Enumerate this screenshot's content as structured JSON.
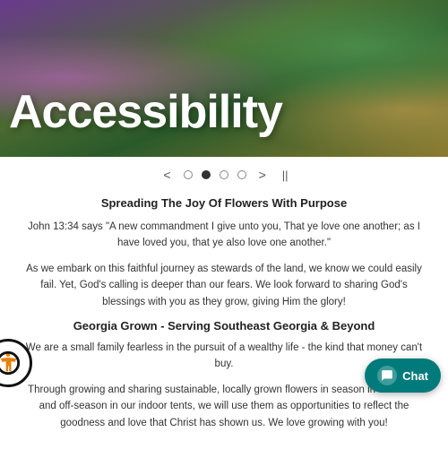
{
  "topbar": {},
  "hero": {
    "title": "Accessibility"
  },
  "carousel": {
    "prev_label": "<",
    "next_label": ">",
    "pause_label": "||",
    "dots": [
      {
        "id": 1,
        "active": false
      },
      {
        "id": 2,
        "active": true
      },
      {
        "id": 3,
        "active": false
      },
      {
        "id": 4,
        "active": false
      }
    ]
  },
  "content": {
    "section1_title": "Spreading The Joy Of Flowers With Purpose",
    "paragraph1": "John 13:34 says \"A new commandment I give unto you, That ye love one another; as I have loved you, that ye also love one another.\"",
    "paragraph2": "As we embark on this faithful journey as stewards of the land, we know we could easily fail. Yet, God's calling is deeper than our fears. We look forward to sharing God's blessings with you as they grow, giving Him the glory!",
    "section2_title": "Georgia Grown - Serving Southeast Georgia & Beyond",
    "paragraph3": "We are a small family fearless in the pursuit of a wealthy life - the kind that money can't buy.",
    "paragraph4": "Through growing and sharing sustainable, locally grown flowers in season in our fields and off-season in our indoor tents, we will use them as opportunities to reflect the goodness and love that Christ has shown us. We love growing with you!"
  },
  "accessibility": {
    "label": "Accessibility"
  },
  "chat": {
    "label": "Chat"
  }
}
